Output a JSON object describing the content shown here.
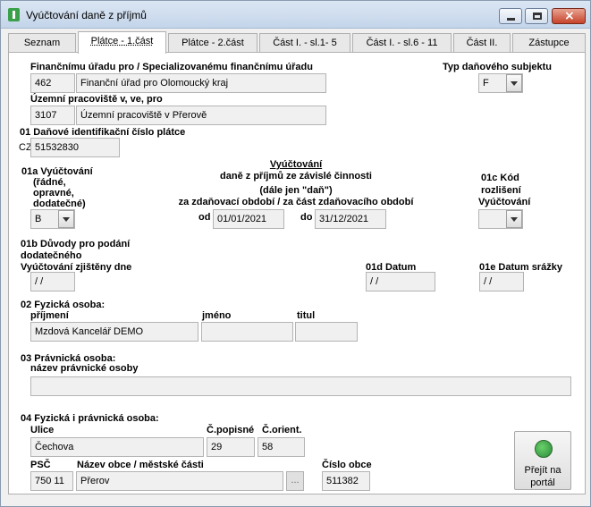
{
  "window": {
    "title": "Vyúčtování daně z příjmů"
  },
  "tabs": [
    {
      "label": "Seznam"
    },
    {
      "label": "Plátce - 1.část"
    },
    {
      "label": "Plátce - 2.část"
    },
    {
      "label": "Část I. - sl.1- 5"
    },
    {
      "label": "Část I. - sl.6 - 11"
    },
    {
      "label": "Část II."
    },
    {
      "label": "Zástupce"
    }
  ],
  "office": {
    "label": "Finančnímu úřadu pro / Specializovanému finančnímu úřadu",
    "code": "462",
    "name": "Finanční úřad pro Olomoucký kraj",
    "workplace_label": "Územní pracoviště v, ve, pro",
    "workplace_code": "3107",
    "workplace_name": "Územní pracoviště v Přerově"
  },
  "subject_type": {
    "label": "Typ daňového subjektu",
    "value": "F"
  },
  "dic": {
    "label": "01 Daňové identifikační číslo plátce",
    "prefix": "CZ",
    "value": "51532830"
  },
  "settlement_type": {
    "label_1": "01a Vyúčtování",
    "label_2": "(řádné,",
    "label_3": "opravné,",
    "label_4": "dodatečné)",
    "value": "B"
  },
  "heading": {
    "title": "Vyúčtování",
    "line2": "daně z příjmů ze závislé činnosti",
    "line3": "(dále jen \"daň\")",
    "line4": "za zdaňovací období / za část zdaňovacího období",
    "from_label": "od",
    "from_value": "01/01/2021",
    "to_label": "do",
    "to_value": "31/12/2021"
  },
  "code_1c": {
    "label_1": "01c Kód",
    "label_2": "rozlišení",
    "label_3": "Vyúčtování",
    "value": ""
  },
  "reasons": {
    "label_1": "01b Důvody pro podání",
    "label_2": "dodatečného",
    "detected_label": "Vyúčtování zjištěny dne",
    "detected_value": " / /"
  },
  "date_1d": {
    "label": "01d Datum",
    "value": " / /"
  },
  "date_1e": {
    "label": "01e Datum srážky",
    "value": " / /"
  },
  "person": {
    "label": "02 Fyzická osoba:",
    "surname_label": "příjmení",
    "surname": "Mzdová Kancelář DEMO",
    "name_label": "jméno",
    "name": "",
    "title_label": "titul",
    "title": ""
  },
  "legal": {
    "label": "03 Právnická osoba:",
    "name_label": "název právnické osoby",
    "name": ""
  },
  "address": {
    "label": "04 Fyzická i právnická osoba:",
    "street_label": "Ulice",
    "street": "Čechova",
    "cp_label": "Č.popisné",
    "cp": "29",
    "co_label": "Č.orient.",
    "co": "58",
    "psc_label": "PSČ",
    "psc": "750 11",
    "city_label": "Název obce / městské části",
    "city": "Přerov",
    "city_btn": "...",
    "city_no_label": "Číslo obce",
    "city_no": "511382"
  },
  "portal_button": {
    "line1": "Přejít na",
    "line2": "portál"
  }
}
